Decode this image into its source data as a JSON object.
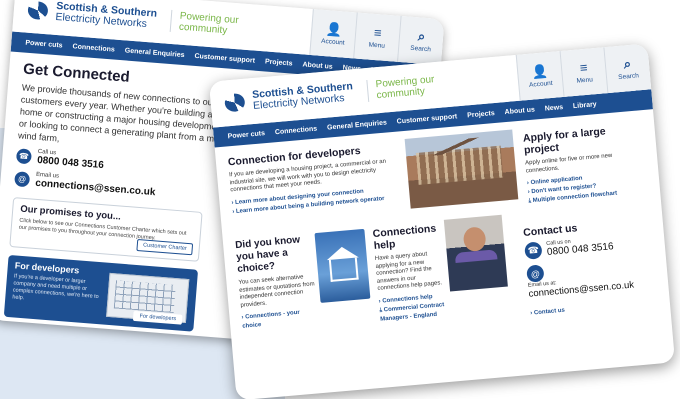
{
  "brand": {
    "name_line1": "Scottish & Southern",
    "name_line2": "Electricity Networks",
    "tagline_line1": "Powering our",
    "tagline_line2": "community"
  },
  "header_buttons": [
    {
      "label": "Account",
      "icon": "user-icon"
    },
    {
      "label": "Menu",
      "icon": "menu-icon"
    },
    {
      "label": "Search",
      "icon": "search-icon"
    }
  ],
  "nav": [
    "Power cuts",
    "Connections",
    "General Enquiries",
    "Customer support",
    "Projects",
    "About us",
    "News",
    "Library"
  ],
  "back_page": {
    "title": "Get Connected",
    "intro": "We provide thousands of new connections to our customers every year. Whether you're building a new home or constructing a major housing development, or looking to connect a generating plant from a major wind farm,",
    "call_label": "Call us",
    "phone": "0800 048 3516",
    "email_label": "Email us",
    "email": "connections@ssen.co.uk",
    "promises_title": "Our promises to you...",
    "promises_text": "Click below to see our Connections Customer Charter which sets out our promises to you throughout your connection journey.",
    "charter_button": "Customer Charter",
    "developers_title": "For developers",
    "developers_text": "If you're a developer or larger company and need multiple or complex connections, we're here to help.",
    "developers_button": "For developers"
  },
  "front_page": {
    "dev_title": "Connection for developers",
    "dev_text": "If you are developing a housing project, a commercial or an industrial site, we will work with you to design electricity connections that meet your needs.",
    "dev_links": [
      "Learn more about designing your connection",
      "Learn more about being a building network operator"
    ],
    "large_title": "Apply for a large project",
    "large_text": "Apply online for five or more new connections.",
    "large_links": [
      "Online application",
      "Don't want to register?",
      "Multiple connection flowchart"
    ],
    "choice_title": "Did you know you have a choice?",
    "choice_text": "You can seek alternative estimates or quotations from independent connection providers.",
    "choice_link": "Connections - your choice",
    "help_title": "Connections help",
    "help_text": "Have a query about applying for a new connection? Find the answers in our connections help pages.",
    "help_links": [
      "Connections help",
      "Commercial Contract Managers - England"
    ],
    "contact_title": "Contact us",
    "call_label": "Call us on",
    "phone": "0800 048 3516",
    "email_label": "Email us at:",
    "email": "connections@ssen.co.uk",
    "contact_link": "Contact us"
  },
  "colors": {
    "brand_blue": "#1d4f91",
    "tagline_green": "#7ab648",
    "background_panel": "#dde7f3"
  }
}
